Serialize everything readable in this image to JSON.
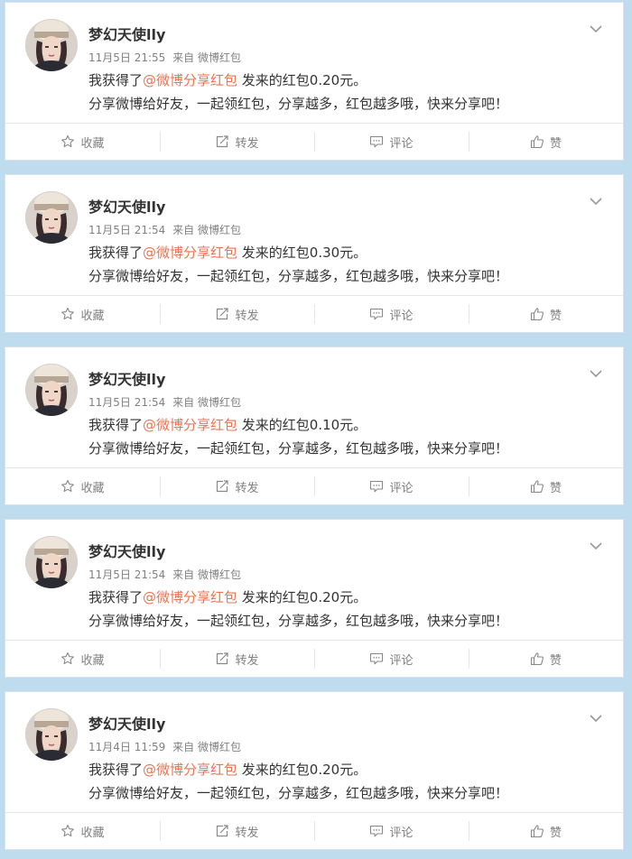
{
  "feed": {
    "posts": [
      {
        "user": "梦幻天使lly",
        "time": "11月5日 21:55",
        "source_prefix": "来自",
        "source": "微博红包",
        "text_before": "我获得了",
        "mention": "@微博分享红包",
        "text_after": " 发来的红包0.20元。",
        "line2": "分享微博给好友，一起领红包，分享越多，红包越多哦，快来分享吧！"
      },
      {
        "user": "梦幻天使lly",
        "time": "11月5日 21:54",
        "source_prefix": "来自",
        "source": "微博红包",
        "text_before": "我获得了",
        "mention": "@微博分享红包",
        "text_after": " 发来的红包0.30元。",
        "line2": "分享微博给好友，一起领红包，分享越多，红包越多哦，快来分享吧！"
      },
      {
        "user": "梦幻天使lly",
        "time": "11月5日 21:54",
        "source_prefix": "来自",
        "source": "微博红包",
        "text_before": "我获得了",
        "mention": "@微博分享红包",
        "text_after": " 发来的红包0.10元。",
        "line2": "分享微博给好友，一起领红包，分享越多，红包越多哦，快来分享吧！"
      },
      {
        "user": "梦幻天使lly",
        "time": "11月5日 21:54",
        "source_prefix": "来自",
        "source": "微博红包",
        "text_before": "我获得了",
        "mention": "@微博分享红包",
        "text_after": " 发来的红包0.20元。",
        "line2": "分享微博给好友，一起领红包，分享越多，红包越多哦，快来分享吧！"
      },
      {
        "user": "梦幻天使lly",
        "time": "11月4日 11:59",
        "source_prefix": "来自",
        "source": "微博红包",
        "text_before": "我获得了",
        "mention": "@微博分享红包",
        "text_after": " 发来的红包0.20元。",
        "line2": "分享微博给好友，一起领红包，分享越多，红包越多哦，快来分享吧！"
      }
    ]
  },
  "actions": {
    "favorite": "收藏",
    "repost": "转发",
    "comment": "评论",
    "like": "赞"
  },
  "icons": {
    "favorite": "star-icon",
    "repost": "repost-icon",
    "comment": "comment-icon",
    "like": "thumbs-up-icon",
    "menu": "chevron-down-icon",
    "avatar": "avatar"
  },
  "colors": {
    "page_background": "#bfdcef",
    "mention": "#eb7350",
    "meta_text": "#808080",
    "body_text": "#333333"
  }
}
